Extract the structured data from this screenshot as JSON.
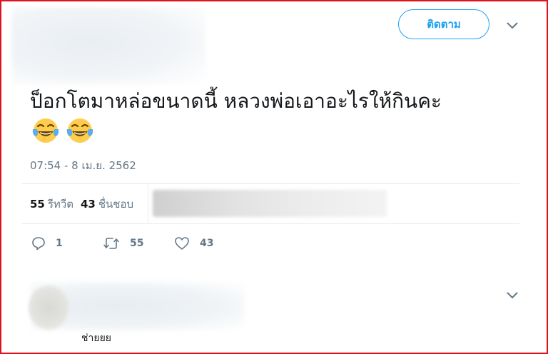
{
  "header": {
    "follow_label": "ติดตาม"
  },
  "tweet": {
    "text": "ป็อกโตมาหล่อขนาดนี้ หลวงพ่อเอาอะไรให้กินคะ",
    "emoji": [
      "face-with-tears-of-joy",
      "face-with-tears-of-joy"
    ],
    "timestamp": "07:54 - 8 เม.ย. 2562"
  },
  "stats": {
    "retweet_count": "55",
    "retweet_label": "รีทวีต",
    "like_count": "43",
    "like_label": "ชื่นชอบ"
  },
  "actions": {
    "reply_count": "1",
    "retweet_count": "55",
    "like_count": "43"
  },
  "reply": {
    "name": "ช่ายยย"
  },
  "colors": {
    "accent": "#1da1f2",
    "muted": "#657786",
    "frame": "#e0121b"
  }
}
